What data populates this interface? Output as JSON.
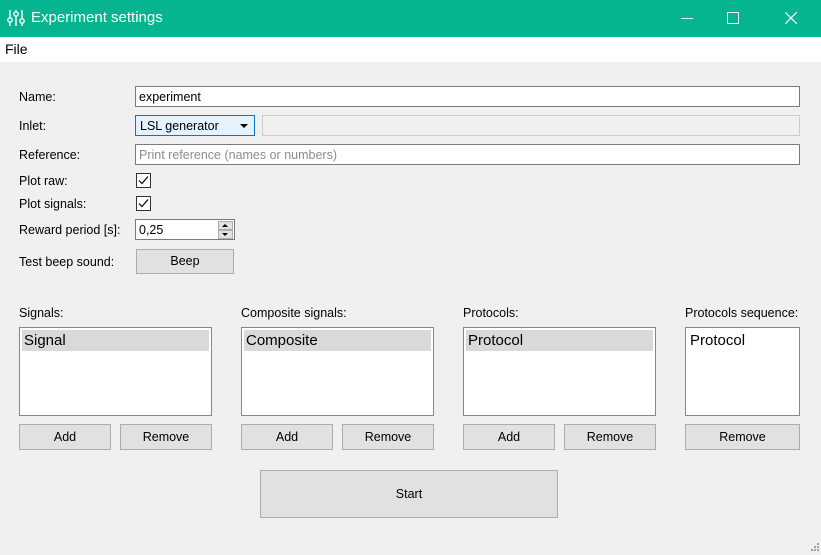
{
  "window": {
    "title": "Experiment settings",
    "icon": "sliders-icon"
  },
  "menu": {
    "file": "File"
  },
  "form": {
    "name_label": "Name:",
    "name_value": "experiment",
    "inlet_label": "Inlet:",
    "inlet_value": "LSL generator",
    "reference_label": "Reference:",
    "reference_placeholder": "Print reference (names or numbers)",
    "plot_raw_label": "Plot raw:",
    "plot_raw_checked": true,
    "plot_signals_label": "Plot signals:",
    "plot_signals_checked": true,
    "reward_label": "Reward period [s]:",
    "reward_value": "0,25",
    "beep_label": "Test beep sound:",
    "beep_button": "Beep"
  },
  "lists": {
    "signals": {
      "label": "Signals:",
      "items": [
        "Signal"
      ],
      "add": "Add",
      "remove": "Remove"
    },
    "composite": {
      "label": "Composite signals:",
      "items": [
        "Composite"
      ],
      "add": "Add",
      "remove": "Remove"
    },
    "protocols": {
      "label": "Protocols:",
      "items": [
        "Protocol"
      ],
      "add": "Add",
      "remove": "Remove"
    },
    "sequence": {
      "label": "Protocols sequence:",
      "items": [
        "Protocol"
      ],
      "remove": "Remove"
    }
  },
  "start_button": "Start",
  "colors": {
    "titlebar": "#05b58f",
    "background": "#f0f0f0",
    "combo_accent": "#0078d7"
  }
}
